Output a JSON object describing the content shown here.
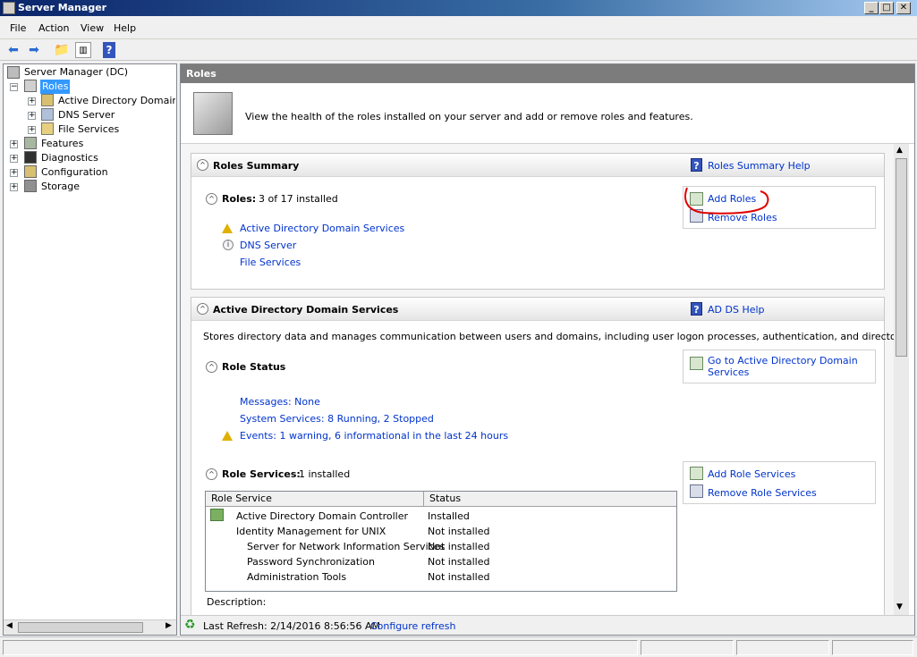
{
  "window": {
    "title": "Server Manager",
    "controls": [
      "_",
      "□",
      "✕"
    ]
  },
  "menu": [
    "File",
    "Action",
    "View",
    "Help"
  ],
  "tree": {
    "root": "Server Manager (DC)",
    "roles": "Roles",
    "role_children": [
      "Active Directory Domain Se",
      "DNS Server",
      "File Services"
    ],
    "others": [
      "Features",
      "Diagnostics",
      "Configuration",
      "Storage"
    ]
  },
  "header": {
    "title": "Roles",
    "description": "View the health of the roles installed on your server and add or remove roles and features."
  },
  "roles_summary": {
    "title": "Roles Summary",
    "help": "Roles Summary Help",
    "roles_label": "Roles:",
    "roles_count": "3 of 17 installed",
    "items": [
      "Active Directory Domain Services",
      "DNS Server",
      "File Services"
    ],
    "add_roles": "Add Roles",
    "remove_roles": "Remove Roles"
  },
  "adds": {
    "title": "Active Directory Domain Services",
    "help": "AD DS Help",
    "description": "Stores directory data and manages communication between users and domains, including user logon processes, authentication, and directory searches.",
    "role_status": "Role Status",
    "goto": "Go to Active Directory Domain Services",
    "messages": "Messages: None",
    "system_services": "System Services: 8 Running, 2 Stopped",
    "events": "Events: 1 warning, 6 informational in the last 24 hours",
    "role_services_label": "Role Services:",
    "role_services_count": "1 installed",
    "add_role_services": "Add Role Services",
    "remove_role_services": "Remove Role Services",
    "table": {
      "headers": [
        "Role Service",
        "Status"
      ],
      "rows": [
        {
          "name": "Active Directory Domain Controller",
          "status": "Installed"
        },
        {
          "name": "Identity Management for UNIX",
          "status": "Not installed"
        },
        {
          "name": "Server for Network Information Services",
          "status": "Not installed"
        },
        {
          "name": "Password Synchronization",
          "status": "Not installed"
        },
        {
          "name": "Administration Tools",
          "status": "Not installed"
        }
      ]
    },
    "description_label": "Description:"
  },
  "footer": {
    "last_refresh": "Last Refresh: 2/14/2016 8:56:56 AM",
    "configure_refresh": "Configure refresh"
  },
  "colors": {
    "link": "#0033cc",
    "header_bar": "#7c7c7c",
    "annotation": "#e00000",
    "warning": "#e0b000"
  }
}
